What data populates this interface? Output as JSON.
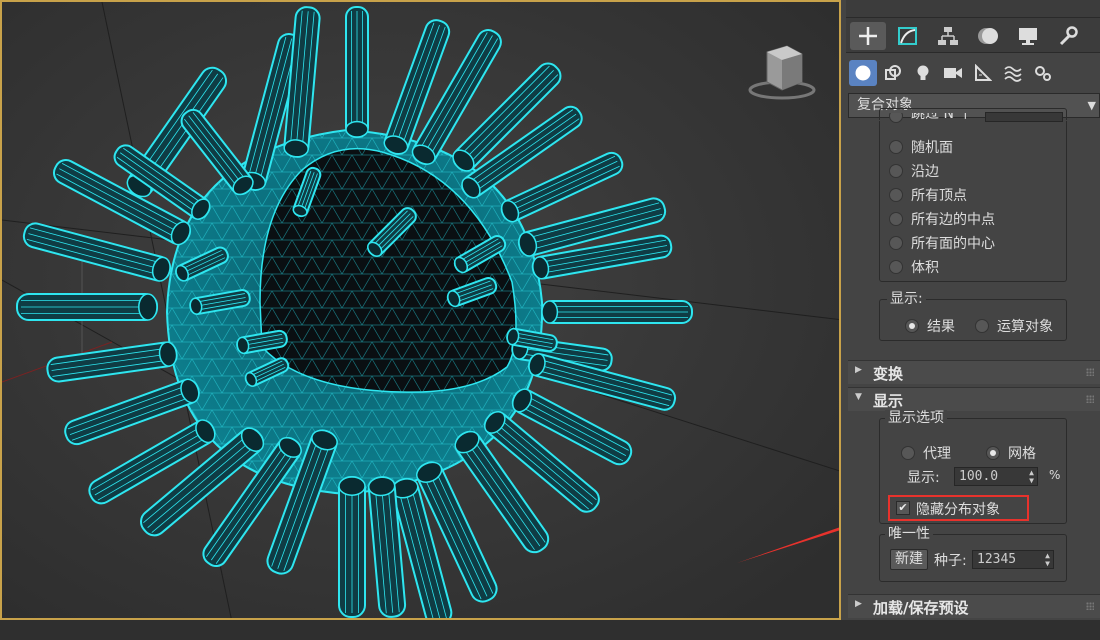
{
  "command_panel": {
    "tabs": [
      {
        "icon": "plus-create-icon",
        "active": true
      },
      {
        "icon": "modify-curve-icon",
        "active": false
      },
      {
        "icon": "hierarchy-icon",
        "active": false
      },
      {
        "icon": "motion-icon",
        "active": false
      },
      {
        "icon": "display-monitor-icon",
        "active": false
      },
      {
        "icon": "utilities-wrench-icon",
        "active": false
      }
    ],
    "subtabs": [
      {
        "icon": "geometry-sphere-icon",
        "active": true
      },
      {
        "icon": "shapes-icon",
        "active": false
      },
      {
        "icon": "lights-bulb-icon",
        "active": false
      },
      {
        "icon": "cameras-icon",
        "active": false
      },
      {
        "icon": "helpers-ruler-icon",
        "active": false
      },
      {
        "icon": "space-warps-icon",
        "active": false
      },
      {
        "icon": "systems-gears-icon",
        "active": false
      }
    ],
    "category_dropdown": "复合对象"
  },
  "distribution": {
    "partial_top_label": "跳过 N 个",
    "options": [
      "随机面",
      "沿边",
      "所有顶点",
      "所有边的中点",
      "所有面的中心",
      "体积"
    ]
  },
  "display_group": {
    "label": "显示:",
    "options": [
      {
        "label": "结果",
        "selected": true
      },
      {
        "label": "运算对象",
        "selected": false
      }
    ]
  },
  "rollouts": {
    "transform": {
      "title": "变换",
      "expanded": false
    },
    "display": {
      "title": "显示",
      "expanded": true
    },
    "load_save": {
      "title": "加载/保存预设",
      "expanded": false
    }
  },
  "display_options": {
    "group_label": "显示选项",
    "proxy_label": "代理",
    "mesh_label": "网格",
    "proxy_selected": false,
    "mesh_selected": true,
    "display_label": "显示:",
    "display_value": "100.0",
    "display_unit": "%",
    "hide_distribution_label": "隐藏分布对象",
    "hide_distribution_checked": true,
    "highlight_color": "#e8322c"
  },
  "uniqueness": {
    "group_label": "唯一性",
    "new_button": "新建",
    "seed_label": "种子:",
    "seed_value": "12345"
  },
  "colors": {
    "viewport_border": "#c8a24a",
    "wireframe": "#2ee6f0",
    "annotation_arrow": "#e8322c"
  }
}
